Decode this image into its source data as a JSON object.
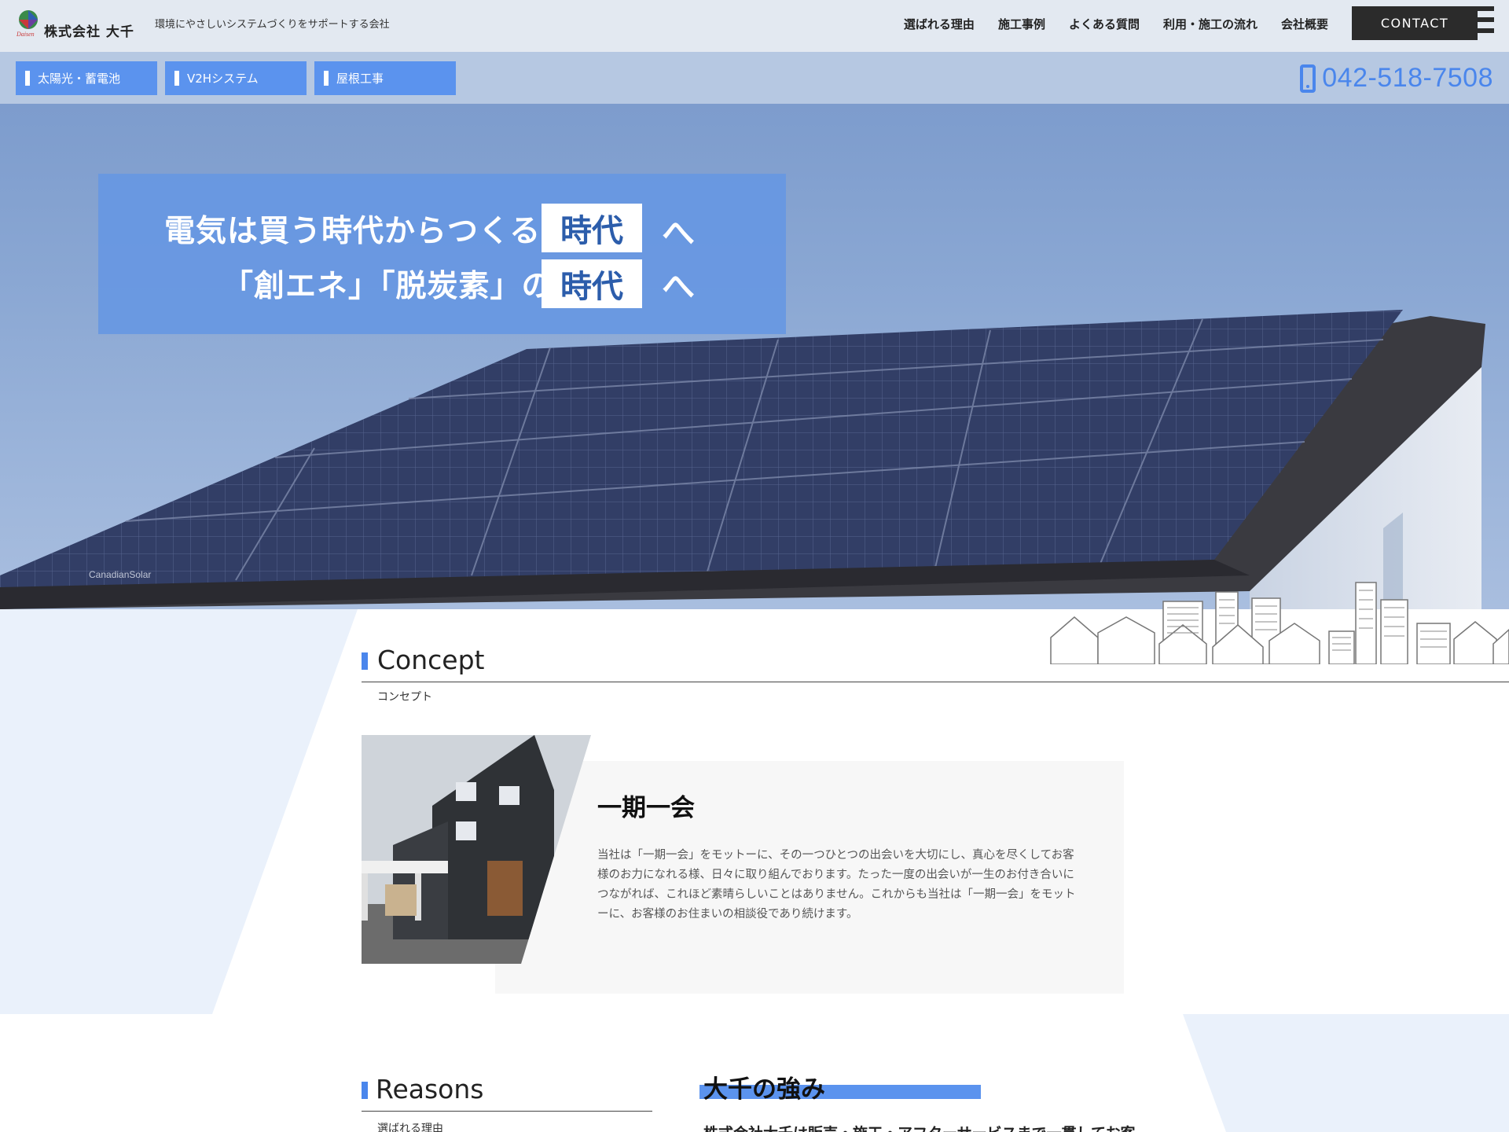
{
  "header": {
    "company": "株式会社 大千",
    "logo_mark_text": "Daisen",
    "tagline": "環境にやさしいシステムづくりをサポートする会社",
    "nav": [
      "選ばれる理由",
      "施工事例",
      "よくある質問",
      "利用・施工の流れ",
      "会社概要"
    ],
    "contact_label": "CONTACT"
  },
  "subbar": {
    "services": [
      "太陽光・蓄電池",
      "V2Hシステム",
      "屋根工事"
    ],
    "phone": "042-518-7508"
  },
  "hero": {
    "line1": "電気は買う時代からつくる",
    "line2": "「創エネ」「脱炭素」の",
    "highlight": "時代",
    "arrow": "へ",
    "panel_brand": "CanadianSolar"
  },
  "concept": {
    "title": "Concept",
    "subtitle": "コンセプト",
    "heading": "一期一会",
    "text": "当社は「一期一会」をモットーに、その一つひとつの出会いを大切にし、真心を尽くしてお客様のお力になれる様、日々に取り組んでおります。たった一度の出会いが一生のお付き合いにつながれば、これほど素晴らしいことはありません。これからも当社は「一期一会」をモットーに、お客様のお住まいの相談役であり続けます。"
  },
  "reasons": {
    "title": "Reasons",
    "subtitle": "選ばれる理由",
    "heading": "大千の強み",
    "text": "株式会社大千は販売・施工・アフターサービスまで一貫してお客"
  },
  "colors": {
    "accent": "#4a86ec",
    "button": "#5b93ee",
    "dark": "#2b2b2b",
    "header_bg": "#e3e9f1",
    "subbar_bg": "#b6c8e2"
  },
  "icons": [
    "logo-mark-icon",
    "smartphone-icon",
    "hamburger-menu-icon",
    "city-skyline-illustration"
  ]
}
